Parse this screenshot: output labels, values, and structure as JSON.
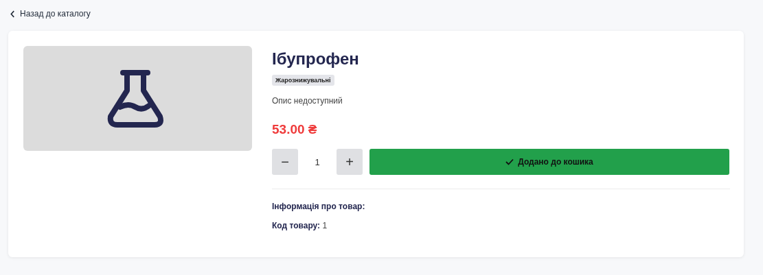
{
  "back_link": {
    "label": "Назад до каталогу"
  },
  "product": {
    "title": "Ібупрофен",
    "category": "Жарознижувальні",
    "description": "Опис недоступний",
    "price": "53.00 ₴"
  },
  "quantity": {
    "decrease": "−",
    "value": "1",
    "increase": "+"
  },
  "cart_button": {
    "label": "Додано до кошика",
    "added": true
  },
  "info": {
    "heading": "Інформація про товар:",
    "code": "**Код товару:** 1"
  }
}
